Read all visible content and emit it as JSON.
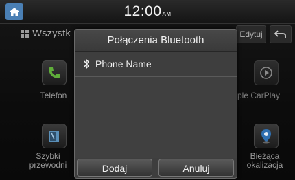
{
  "status_bar": {
    "time": "12:00",
    "ampm": "AM"
  },
  "top_row": {
    "all_label": "Wszystk",
    "edit_label": "Edytuj"
  },
  "apps": {
    "telefon": "Telefon",
    "szybki_line1": "Szybki",
    "szybki_line2": "przewodni",
    "carplay": "ple CarPlay",
    "biezaca_line1": "Bieżąca",
    "biezaca_line2": "okalizacja"
  },
  "dialog": {
    "title": "Połączenia Bluetooth",
    "devices": [
      {
        "name": "Phone Name"
      }
    ],
    "add_label": "Dodaj",
    "cancel_label": "Anuluj"
  },
  "colors": {
    "home_button": "#4a7fb4",
    "phone_icon": "#5fae3a",
    "location_icon": "#2f6fb0"
  },
  "icons": [
    "home-icon",
    "grid-icon",
    "back-icon",
    "phone-icon",
    "guide-icon",
    "carplay-icon",
    "location-icon",
    "bluetooth-icon"
  ]
}
